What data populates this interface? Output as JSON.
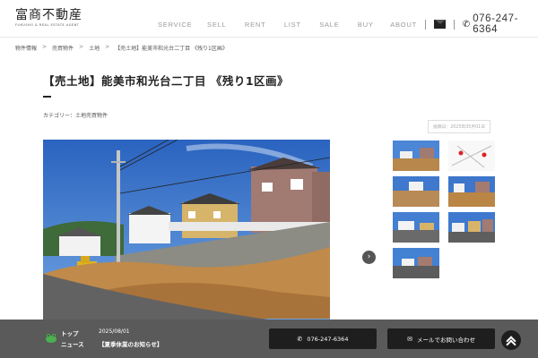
{
  "header": {
    "logo_main": "富商不動産",
    "logo_sub": "FUKUSHO & REAL ESTATE AGENT",
    "nav": [
      "SERVICE",
      "SELL",
      "RENT",
      "LIST",
      "SALE",
      "BUY",
      "ABOUT"
    ],
    "tel": "076-247-6364"
  },
  "breadcrumb": [
    "物件情報",
    "売買物件",
    "土地",
    "【売土地】能美市和光台二丁目 《残り1区画》"
  ],
  "title": "【売土地】能美市和光台二丁目 《残り1区画》",
  "category": "カテゴリー：土地売買物件",
  "date_badge": "投稿日：2025年05月01日",
  "bottom": {
    "news_label_1": "トップ",
    "news_label_2": "ニュース",
    "news_date": "2025/08/01",
    "news_text": "【夏季休業のお知らせ】",
    "tel_button": "076-247-6364",
    "mail_button": "メールでお問い合わせ"
  },
  "colors": {
    "bottom_bar": "#5a5a5a",
    "button": "#1e1e1e",
    "sky": "#2f6fc4"
  },
  "icons": [
    "mail-icon",
    "phone-icon",
    "next-arrow-icon",
    "pagetop-icon",
    "frog-icon"
  ]
}
